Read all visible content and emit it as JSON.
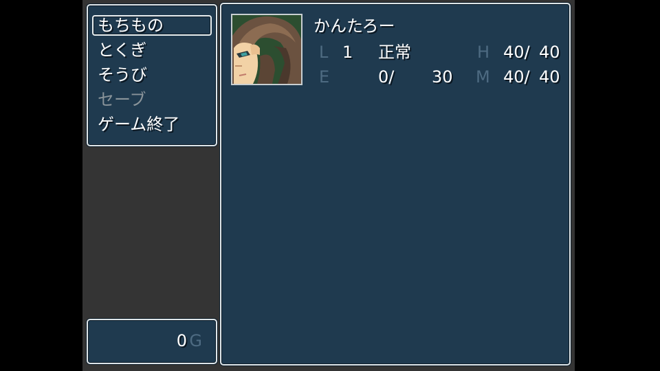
{
  "menu": {
    "items": [
      {
        "label": "もちもの",
        "enabled": true
      },
      {
        "label": "とくぎ",
        "enabled": true
      },
      {
        "label": "そうび",
        "enabled": true
      },
      {
        "label": "セーブ",
        "enabled": false
      },
      {
        "label": "ゲーム終了",
        "enabled": true
      }
    ],
    "selected_index": 0
  },
  "gold": {
    "amount": "0",
    "unit": "G"
  },
  "actor": {
    "name": "かんたろー",
    "level_label": "L",
    "level": "1",
    "state": "正常",
    "hp_label": "H",
    "hp": "40/",
    "hp_max": "40",
    "exp_label": "E",
    "exp": "0/",
    "exp_next": "30",
    "mp_label": "M",
    "mp": "40/",
    "mp_max": "40"
  },
  "colors": {
    "window_bg": "#1f3a4f",
    "window_border": "#dfe6ea",
    "system_text": "#4e6b82",
    "disabled_text": "#8a949a",
    "background": "#343434"
  }
}
